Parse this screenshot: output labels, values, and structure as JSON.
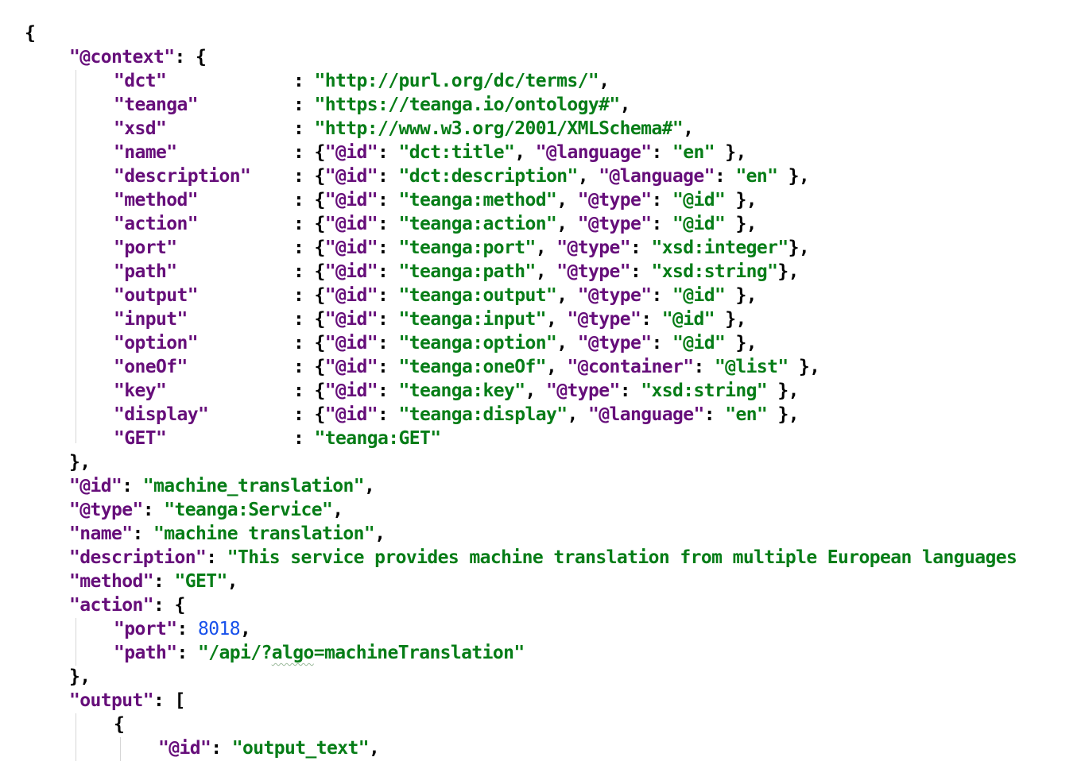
{
  "context": {
    "key": "\"@context\"",
    "entries": [
      {
        "key": "\"dct\"",
        "value": "\"http://purl.org/dc/terms/\"",
        "kind": "string"
      },
      {
        "key": "\"teanga\"",
        "value": "\"https://teanga.io/ontology#\"",
        "kind": "string"
      },
      {
        "key": "\"xsd\"",
        "value": "\"http://www.w3.org/2001/XMLSchema#\"",
        "kind": "string"
      },
      {
        "key": "\"name\"",
        "kind": "object",
        "id": "\"dct:title\"",
        "attr_key": "\"@language\"",
        "attr_value": "\"en\"",
        "spacing": " "
      },
      {
        "key": "\"description\"",
        "kind": "object",
        "id": "\"dct:description\"",
        "attr_key": "\"@language\"",
        "attr_value": "\"en\"",
        "spacing": " "
      },
      {
        "key": "\"method\"",
        "kind": "object",
        "id": "\"teanga:method\"",
        "attr_key": "\"@type\"",
        "attr_value": "\"@id\"",
        "spacing": " "
      },
      {
        "key": "\"action\"",
        "kind": "object",
        "id": "\"teanga:action\"",
        "attr_key": "\"@type\"",
        "attr_value": "\"@id\"",
        "spacing": " "
      },
      {
        "key": "\"port\"",
        "kind": "object",
        "id": "\"teanga:port\"",
        "attr_key": "\"@type\"",
        "attr_value": "\"xsd:integer\"",
        "spacing": ""
      },
      {
        "key": "\"path\"",
        "kind": "object",
        "id": "\"teanga:path\"",
        "attr_key": "\"@type\"",
        "attr_value": "\"xsd:string\"",
        "spacing": ""
      },
      {
        "key": "\"output\"",
        "kind": "object",
        "id": "\"teanga:output\"",
        "attr_key": "\"@type\"",
        "attr_value": "\"@id\"",
        "spacing": " "
      },
      {
        "key": "\"input\"",
        "kind": "object",
        "id": "\"teanga:input\"",
        "attr_key": "\"@type\"",
        "attr_value": "\"@id\"",
        "spacing": " "
      },
      {
        "key": "\"option\"",
        "kind": "object",
        "id": "\"teanga:option\"",
        "attr_key": "\"@type\"",
        "attr_value": "\"@id\"",
        "spacing": " "
      },
      {
        "key": "\"oneOf\"",
        "kind": "object",
        "id": "\"teanga:oneOf\"",
        "attr_key": "\"@container\"",
        "attr_value": "\"@list\"",
        "spacing": " "
      },
      {
        "key": "\"key\"",
        "kind": "object",
        "id": "\"teanga:key\"",
        "attr_key": "\"@type\"",
        "attr_value": "\"xsd:string\"",
        "spacing": " "
      },
      {
        "key": "\"display\"",
        "kind": "object",
        "id": "\"teanga:display\"",
        "attr_key": "\"@language\"",
        "attr_value": "\"en\"",
        "spacing": " "
      },
      {
        "key": "\"GET\"",
        "value": "\"teanga:GET\"",
        "kind": "string",
        "last": true
      }
    ]
  },
  "top_fields": [
    {
      "key": "\"@id\"",
      "value": "\"machine_translation\""
    },
    {
      "key": "\"@type\"",
      "value": "\"teanga:Service\""
    },
    {
      "key": "\"name\"",
      "value": "\"machine translation\""
    },
    {
      "key": "\"description\"",
      "value": "\"This service provides machine translation from multiple European languages"
    },
    {
      "key": "\"method\"",
      "value": "\"GET\""
    }
  ],
  "action": {
    "key": "\"action\"",
    "port_key": "\"port\"",
    "port_value": "8018",
    "path_key": "\"path\"",
    "path_value_prefix": "\"/api/?",
    "path_value_flagged": "algo",
    "path_value_suffix": "=machineTranslation\""
  },
  "output": {
    "key": "\"output\"",
    "item_id_key": "\"@id\"",
    "item_id_value": "\"output_text\""
  },
  "id_key": "\"@id\"",
  "colors": {
    "key": "#660e7a",
    "string": "#067d17",
    "number": "#1750eb",
    "punctuation": "#000000",
    "indent_guide": "#d6d6d6",
    "typo_squiggle": "#9ab99a",
    "background": "#ffffff"
  }
}
